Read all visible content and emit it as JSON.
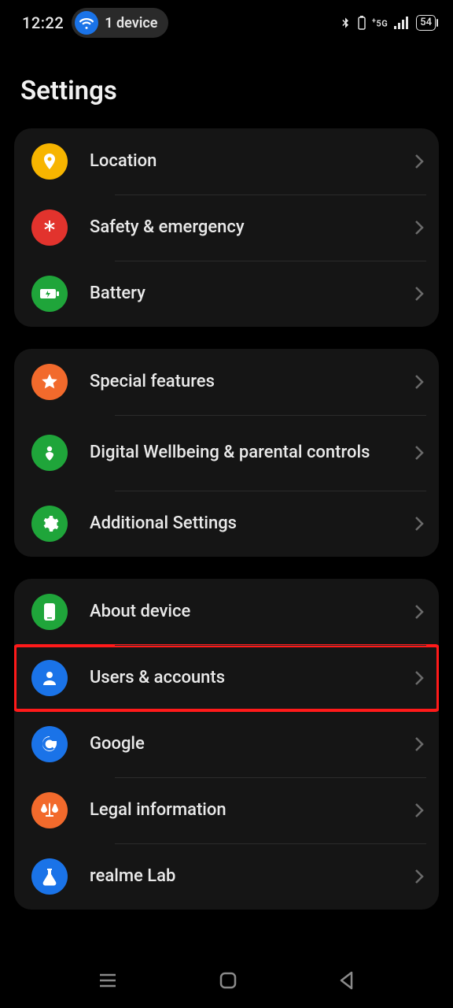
{
  "status": {
    "time": "12:22",
    "device_chip": "1 device",
    "network_label": "5G",
    "battery_pct": "54"
  },
  "header": {
    "title": "Settings"
  },
  "groups": [
    {
      "rows": [
        {
          "key": "location",
          "label": "Location"
        },
        {
          "key": "safety",
          "label": "Safety & emergency"
        },
        {
          "key": "battery",
          "label": "Battery"
        }
      ]
    },
    {
      "rows": [
        {
          "key": "special",
          "label": "Special features"
        },
        {
          "key": "wellbeing",
          "label": "Digital Wellbeing & parental controls"
        },
        {
          "key": "additional",
          "label": "Additional Settings"
        }
      ]
    },
    {
      "rows": [
        {
          "key": "about",
          "label": "About device"
        },
        {
          "key": "users",
          "label": "Users & accounts",
          "highlighted": true
        },
        {
          "key": "google",
          "label": "Google"
        },
        {
          "key": "legal",
          "label": "Legal information"
        },
        {
          "key": "lab",
          "label": "realme Lab"
        }
      ]
    }
  ]
}
